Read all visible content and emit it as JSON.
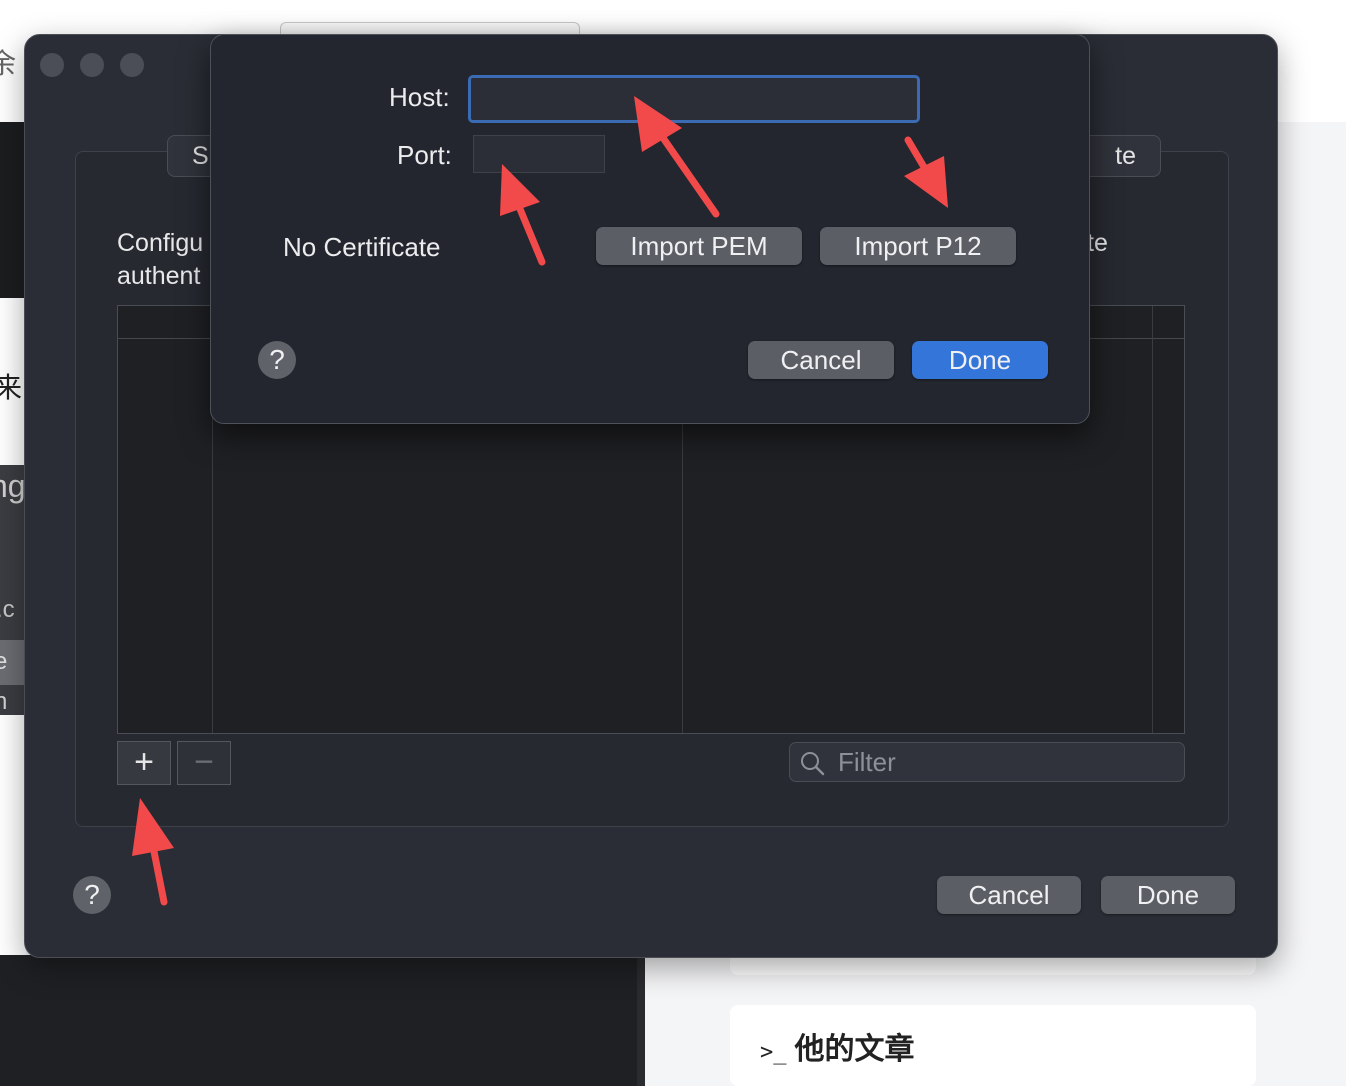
{
  "background": {
    "fragments": [
      "余",
      "来",
      "ng",
      ".c",
      "e",
      "n"
    ],
    "card_prompt": ">_",
    "card_title": "他的文章"
  },
  "sheet": {
    "segment_left": "S",
    "segment_right": "te",
    "description": "Configu\nauthent",
    "description_right": "te",
    "add_label": "+",
    "remove_label": "−",
    "filter_placeholder": "Filter",
    "help_label": "?",
    "cancel_label": "Cancel",
    "done_label": "Done"
  },
  "dialog": {
    "host_label": "Host:",
    "host_value": "",
    "port_label": "Port:",
    "port_value": "",
    "certificate_status": "No Certificate",
    "import_pem_label": "Import PEM",
    "import_p12_label": "Import P12",
    "help_label": "?",
    "cancel_label": "Cancel",
    "done_label": "Done"
  },
  "colors": {
    "accent_blue": "#3475d9",
    "annotation_arrow": "#f24a4a"
  }
}
